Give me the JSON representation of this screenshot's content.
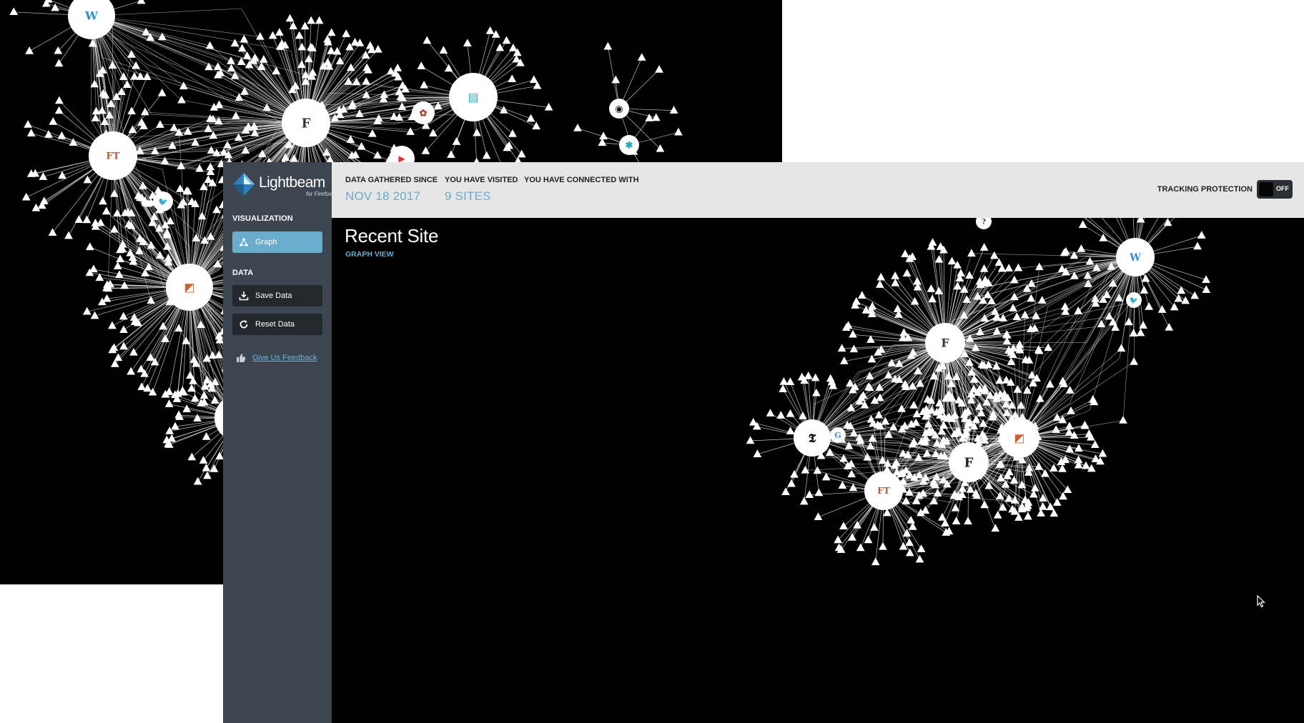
{
  "app": {
    "name": "Lightbeam",
    "tagline": "for Firefox"
  },
  "sidebar": {
    "visualization_heading": "VISUALIZATION",
    "graph_button_label": "Graph",
    "data_heading": "DATA",
    "save_data_label": "Save Data",
    "reset_data_label": "Reset Data",
    "feedback_label": "Give Us Feedback"
  },
  "header": {
    "data_gathered_label": "DATA GATHERED SINCE",
    "data_gathered_value": "NOV 18 2017",
    "visited_label": "YOU HAVE VISITED",
    "visited_value": "9 SITES",
    "connected_label": "YOU HAVE CONNECTED WITH",
    "connected_value": "",
    "tracking_protection_label": "TRACKING PROTECTION",
    "tracking_protection_state": "OFF"
  },
  "main": {
    "title": "Recent Site",
    "subtitle": "GRAPH VIEW"
  },
  "colors": {
    "accent": "#6aaccc",
    "sidebar": "#3c4550",
    "header": "#e6e6e6",
    "graph_background": "#000000",
    "node": "#ffffff"
  },
  "graph_main": {
    "visited_sites": [
      "wordpress",
      "facebook",
      "nytimes",
      "financial-times",
      "forbes",
      "office",
      "twitter",
      "google",
      "unknown-site"
    ],
    "icons": {
      "wordpress": "W",
      "facebook": "F",
      "forbes": "F",
      "nytimes": "𝕿",
      "financial-times": "FT",
      "google": "G",
      "office": "◩"
    }
  },
  "graph_background": {
    "visited_sites": [
      "wordpress",
      "facebook",
      "financial-times",
      "twitter",
      "office",
      "unknown-site",
      "bitly",
      "github",
      "youtube",
      "data-site",
      "partial-site"
    ],
    "icons": {
      "wordpress": "W",
      "facebook": "F",
      "financial-times": "FT",
      "github": "◉",
      "youtube": "▶",
      "unknown-site": "✱"
    }
  }
}
